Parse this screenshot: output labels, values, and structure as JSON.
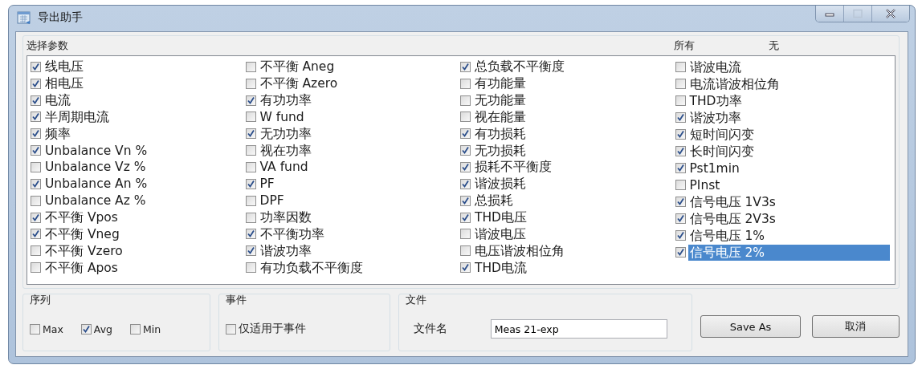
{
  "window": {
    "title": "导出助手"
  },
  "parameters": {
    "title": "选择参数",
    "select_all": "所有",
    "select_none": "无",
    "columns": [
      {
        "items": [
          {
            "label": "线电压",
            "checked": true,
            "selected": false
          },
          {
            "label": "相电压",
            "checked": true,
            "selected": false
          },
          {
            "label": "电流",
            "checked": true,
            "selected": false
          },
          {
            "label": "半周期电流",
            "checked": true,
            "selected": false
          },
          {
            "label": "频率",
            "checked": true,
            "selected": false
          },
          {
            "label": "Unbalance Vn %",
            "checked": true,
            "selected": false
          },
          {
            "label": "Unbalance Vz %",
            "checked": false,
            "selected": false
          },
          {
            "label": "Unbalance An %",
            "checked": true,
            "selected": false
          },
          {
            "label": "Unbalance Az %",
            "checked": false,
            "selected": false
          },
          {
            "label": "不平衡 Vpos",
            "checked": true,
            "selected": false
          },
          {
            "label": "不平衡 Vneg",
            "checked": true,
            "selected": false
          },
          {
            "label": "不平衡 Vzero",
            "checked": false,
            "selected": false
          },
          {
            "label": "不平衡 Apos",
            "checked": false,
            "selected": false
          }
        ]
      },
      {
        "items": [
          {
            "label": "不平衡 Aneg",
            "checked": false,
            "selected": false
          },
          {
            "label": "不平衡 Azero",
            "checked": false,
            "selected": false
          },
          {
            "label": "有功功率",
            "checked": true,
            "selected": false
          },
          {
            "label": "W fund",
            "checked": false,
            "selected": false
          },
          {
            "label": "无功功率",
            "checked": true,
            "selected": false
          },
          {
            "label": "视在功率",
            "checked": false,
            "selected": false
          },
          {
            "label": "VA fund",
            "checked": false,
            "selected": false
          },
          {
            "label": "PF",
            "checked": true,
            "selected": false
          },
          {
            "label": "DPF",
            "checked": false,
            "selected": false
          },
          {
            "label": "功率因数",
            "checked": false,
            "selected": false
          },
          {
            "label": "不平衡功率",
            "checked": true,
            "selected": false
          },
          {
            "label": "谐波功率",
            "checked": true,
            "selected": false
          },
          {
            "label": "有功负载不平衡度",
            "checked": false,
            "selected": false
          }
        ]
      },
      {
        "items": [
          {
            "label": "总负载不平衡度",
            "checked": true,
            "selected": false
          },
          {
            "label": "有功能量",
            "checked": false,
            "selected": false
          },
          {
            "label": "无功能量",
            "checked": false,
            "selected": false
          },
          {
            "label": "视在能量",
            "checked": false,
            "selected": false
          },
          {
            "label": "有功损耗",
            "checked": true,
            "selected": false
          },
          {
            "label": "无功损耗",
            "checked": true,
            "selected": false
          },
          {
            "label": "损耗不平衡度",
            "checked": true,
            "selected": false
          },
          {
            "label": "谐波损耗",
            "checked": true,
            "selected": false
          },
          {
            "label": "总损耗",
            "checked": true,
            "selected": false
          },
          {
            "label": "THD电压",
            "checked": true,
            "selected": false
          },
          {
            "label": "谐波电压",
            "checked": false,
            "selected": false
          },
          {
            "label": "电压谐波相位角",
            "checked": false,
            "selected": false
          },
          {
            "label": "THD电流",
            "checked": true,
            "selected": false
          }
        ]
      },
      {
        "items": [
          {
            "label": "谐波电流",
            "checked": false,
            "selected": false
          },
          {
            "label": "电流谐波相位角",
            "checked": false,
            "selected": false
          },
          {
            "label": "THD功率",
            "checked": false,
            "selected": false
          },
          {
            "label": "谐波功率",
            "checked": true,
            "selected": false
          },
          {
            "label": "短时间闪变",
            "checked": true,
            "selected": false
          },
          {
            "label": "长时间闪变",
            "checked": true,
            "selected": false
          },
          {
            "label": "Pst1min",
            "checked": true,
            "selected": false
          },
          {
            "label": "PInst",
            "checked": false,
            "selected": false
          },
          {
            "label": "信号电压 1V3s",
            "checked": true,
            "selected": false
          },
          {
            "label": "信号电压 2V3s",
            "checked": true,
            "selected": false
          },
          {
            "label": "信号电压 1%",
            "checked": true,
            "selected": false
          },
          {
            "label": "信号电压 2%",
            "checked": true,
            "selected": true
          }
        ]
      }
    ]
  },
  "sequence": {
    "title": "序列",
    "options": [
      {
        "label": "Max",
        "checked": false
      },
      {
        "label": "Avg",
        "checked": true
      },
      {
        "label": "Min",
        "checked": false
      }
    ]
  },
  "events": {
    "title": "事件",
    "options": [
      {
        "label": "仅适用于事件",
        "checked": false
      }
    ]
  },
  "file": {
    "title": "文件",
    "label": "文件名",
    "value": "Meas 21-exp"
  },
  "buttons": [
    "Save As",
    "取消"
  ]
}
